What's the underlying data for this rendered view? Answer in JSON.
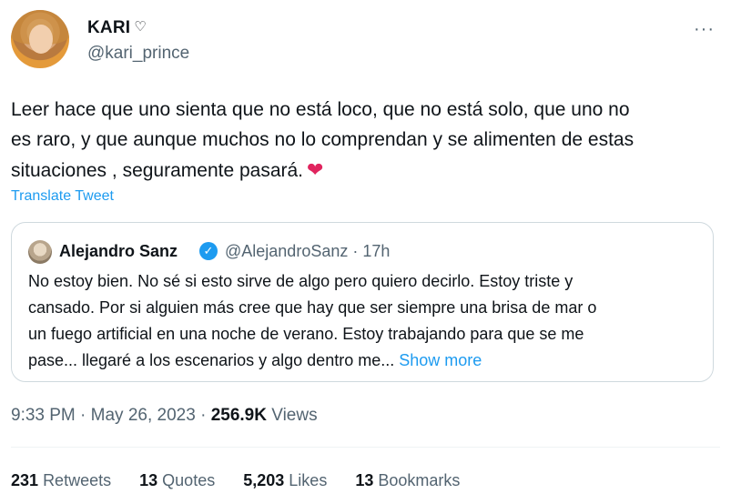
{
  "author": {
    "display_name": "KARI",
    "badge_glyph": "♡",
    "handle": "@kari_prince"
  },
  "more_menu": "···",
  "tweet": {
    "text_lines": [
      "Leer hace que uno sienta que no está loco, que no está solo, que uno no",
      "es raro, y que aunque muchos no lo comprendan y se alimenten de estas",
      "situaciones , seguramente pasará."
    ],
    "emoji": "❤",
    "translate_label": "Translate Tweet"
  },
  "quoted_tweet": {
    "author_name": "Alejandro Sanz",
    "verified_glyph": "✓",
    "handle": "@AlejandroSanz",
    "separator": "·",
    "age": "17h",
    "text_lines": [
      "No estoy bien. No sé si esto sirve de algo pero quiero decirlo. Estoy triste y",
      "cansado. Por si alguien más cree que hay que ser siempre una brisa de mar o",
      "un fuego artificial en una noche de verano. Estoy trabajando para que se me",
      "pase... llegaré a los escenarios y algo dentro me..."
    ],
    "show_more_label": "Show more"
  },
  "meta": {
    "time": "9:33 PM",
    "date": "May 26, 2023",
    "views_count": "256.9K",
    "views_label": "Views",
    "separator": "·"
  },
  "stats": {
    "retweets_count": "231",
    "retweets_label": "Retweets",
    "quotes_count": "13",
    "quotes_label": "Quotes",
    "likes_count": "5,203",
    "likes_label": "Likes",
    "bookmarks_count": "13",
    "bookmarks_label": "Bookmarks"
  },
  "colors": {
    "accent": "#1d9bf0",
    "secondary_text": "#536471",
    "heart": "#e0245e",
    "border": "#cfd9de"
  }
}
